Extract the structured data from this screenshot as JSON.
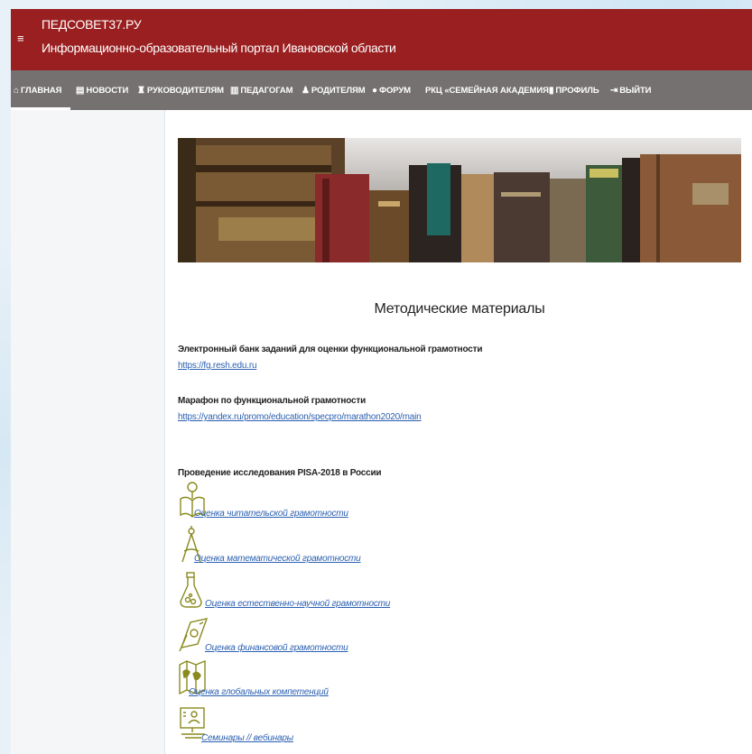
{
  "header": {
    "menu_icon": "≡",
    "title": "ПЕДСОВЕТ37.РУ",
    "subtitle": "Информационно-образовательный портал Ивановской области"
  },
  "nav": [
    {
      "label": "ГЛАВНАЯ",
      "icon": "home-icon",
      "glyph": "⌂",
      "active": true
    },
    {
      "label": "НОВОСТИ",
      "icon": "news-icon",
      "glyph": "▤"
    },
    {
      "label": "РУКОВОДИТЕЛЯМ",
      "icon": "manager-icon",
      "glyph": "♜"
    },
    {
      "label": "ПЕДАГОГАМ",
      "icon": "teacher-icon",
      "glyph": "▥"
    },
    {
      "label": "РОДИТЕЛЯМ",
      "icon": "parents-icon",
      "glyph": "♟"
    },
    {
      "label": "ФОРУМ",
      "icon": "forum-icon",
      "glyph": "●"
    },
    {
      "label": "РКЦ «СЕМЕЙНАЯ АКАДЕМИЯ»",
      "icon": "",
      "glyph": ""
    },
    {
      "label": "ПРОФИЛЬ",
      "icon": "profile-icon",
      "glyph": "▮"
    },
    {
      "label": "ВЫЙТИ",
      "icon": "logout-icon",
      "glyph": "⇥"
    }
  ],
  "main": {
    "heading": "Методические материалы",
    "bank": {
      "title": "Электронный банк заданий для оценки функциональной грамотности",
      "link": "https://fg.resh.edu.ru"
    },
    "marathon": {
      "title": "Марафон по функциональной грамотности",
      "link": "https://yandex.ru/promo/education/specpro/marathon2020/main"
    },
    "pisa": {
      "title": "Проведение исследования PISA-2018 в России",
      "items": [
        {
          "label": "Оценка читательской грамотности",
          "icon": "reading-book-icon"
        },
        {
          "label": "Оценка математической грамотности",
          "icon": "compass-icon"
        },
        {
          "label": "Оценка естественно-научной грамотности",
          "icon": "flask-icon"
        },
        {
          "label": "Оценка финансовой грамотности",
          "icon": "money-icon"
        },
        {
          "label": "Оценка глобальных компетенций",
          "icon": "world-map-icon"
        },
        {
          "label": "Семинары // вебинары",
          "icon": "webinar-screen-icon"
        }
      ]
    }
  },
  "colors": {
    "header_bg": "#9a1f20",
    "nav_bg": "#757171",
    "link": "#2a5fb0",
    "icon_olive": "#8a8a1e"
  }
}
